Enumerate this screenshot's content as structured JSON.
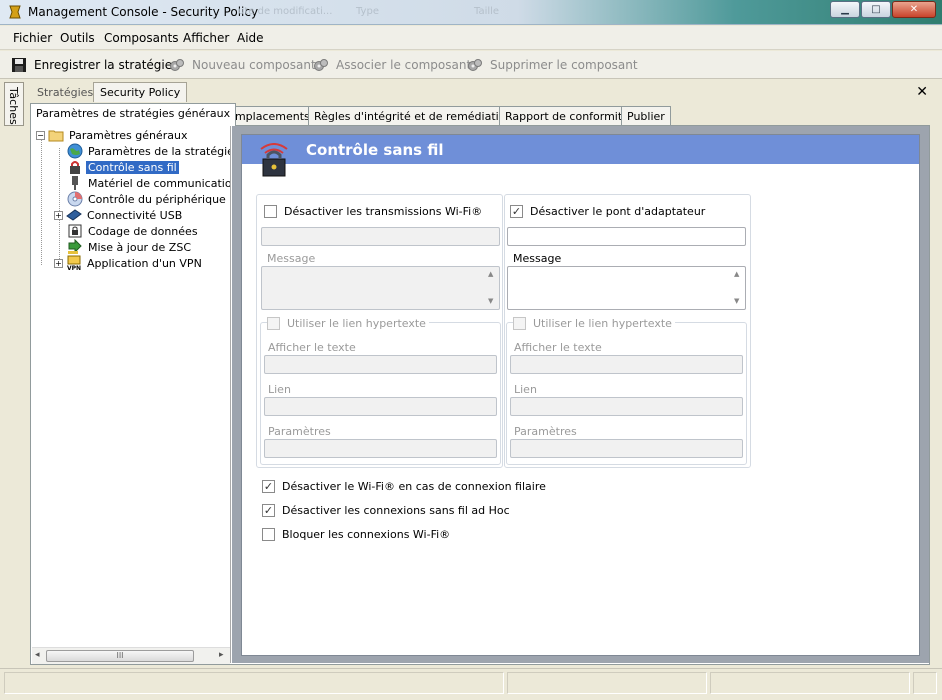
{
  "window": {
    "title": "Management Console  -  Security Policy",
    "ghost_texts": [
      "ute de modificati...",
      "Type",
      "Taille"
    ]
  },
  "menu": [
    "Fichier",
    "Outils",
    "Composants",
    "Afficher",
    "Aide"
  ],
  "toolbar": {
    "save": "Enregistrer la stratégie",
    "new_component": "Nouveau composant",
    "associate_component": "Associer le composant",
    "delete_component": "Supprimer le composant"
  },
  "side_strip": "Tâches",
  "outer_tabs": [
    "Stratégies",
    "Security Policy"
  ],
  "inner_tabs": [
    "Paramètres de stratégies généraux",
    "Emplacements",
    "Règles d'intégrité et de remédiation",
    "Rapport de conformité",
    "Publier"
  ],
  "tree": {
    "root": "Paramètres généraux",
    "items": [
      "Paramètres de la stratégie",
      "Contrôle sans fil",
      "Matériel de communication",
      "Contrôle du périphérique d",
      "Connectivité USB",
      "Codage de données",
      "Mise à jour de ZSC",
      "Application d'un VPN"
    ],
    "scroll_grip": "III"
  },
  "panel": {
    "title": "Contrôle sans fil",
    "left_group": {
      "checkbox_label": "Désactiver les transmissions Wi-Fi®",
      "checked": false,
      "field_value": "",
      "message_label": "Message",
      "hyperlink_label": "Utiliser le lien hypertexte",
      "display_text_label": "Afficher le texte",
      "link_label": "Lien",
      "params_label": "Paramètres"
    },
    "right_group": {
      "checkbox_label": "Désactiver le pont d'adaptateur",
      "checked": true,
      "field_value": "",
      "message_label": "Message",
      "hyperlink_label": "Utiliser le lien hypertexte",
      "display_text_label": "Afficher le texte",
      "link_label": "Lien",
      "params_label": "Paramètres"
    },
    "options": [
      {
        "label": "Désactiver le Wi-Fi® en cas de connexion filaire",
        "checked": true
      },
      {
        "label": "Désactiver les connexions sans fil ad Hoc",
        "checked": true
      },
      {
        "label": "Bloquer les connexions Wi-Fi®",
        "checked": false
      }
    ]
  },
  "colors": {
    "panel_header": "#6f8fd8",
    "tree_selection": "#316ac5"
  }
}
